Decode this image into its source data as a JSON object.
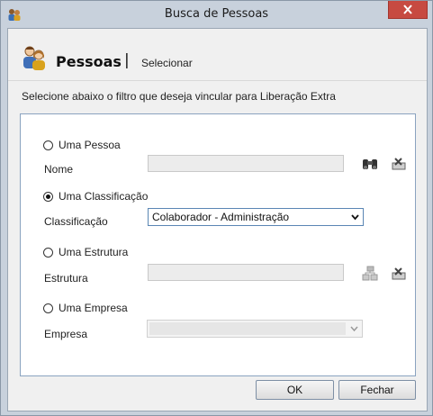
{
  "window": {
    "title": "Busca de Pessoas"
  },
  "header": {
    "title": "Pessoas",
    "separator": "|",
    "subtitle": "Selecionar"
  },
  "instruction": "Selecione abaixo o filtro que deseja vincular para Liberação Extra",
  "options": {
    "pessoa": {
      "radio_label": "Uma Pessoa",
      "field_label": "Nome",
      "value": "",
      "selected": false
    },
    "classificacao": {
      "radio_label": "Uma Classificação",
      "field_label": "Classificação",
      "value": "Colaborador - Administração",
      "selected": true
    },
    "estrutura": {
      "radio_label": "Uma Estrutura",
      "field_label": "Estrutura",
      "value": "",
      "selected": false
    },
    "empresa": {
      "radio_label": "Uma Empresa",
      "field_label": "Empresa",
      "value": "",
      "selected": false
    }
  },
  "buttons": {
    "ok": "OK",
    "close": "Fechar"
  },
  "icons": {
    "app": "people-icon",
    "header": "people-icon",
    "search": "binoculars-icon",
    "clear": "eraser-icon",
    "hierarchy": "structure-icon"
  },
  "colors": {
    "titlebar": "#c8d1dc",
    "close": "#c74a41",
    "panel_border": "#8aa3c0",
    "focus_border": "#5a86b4"
  }
}
